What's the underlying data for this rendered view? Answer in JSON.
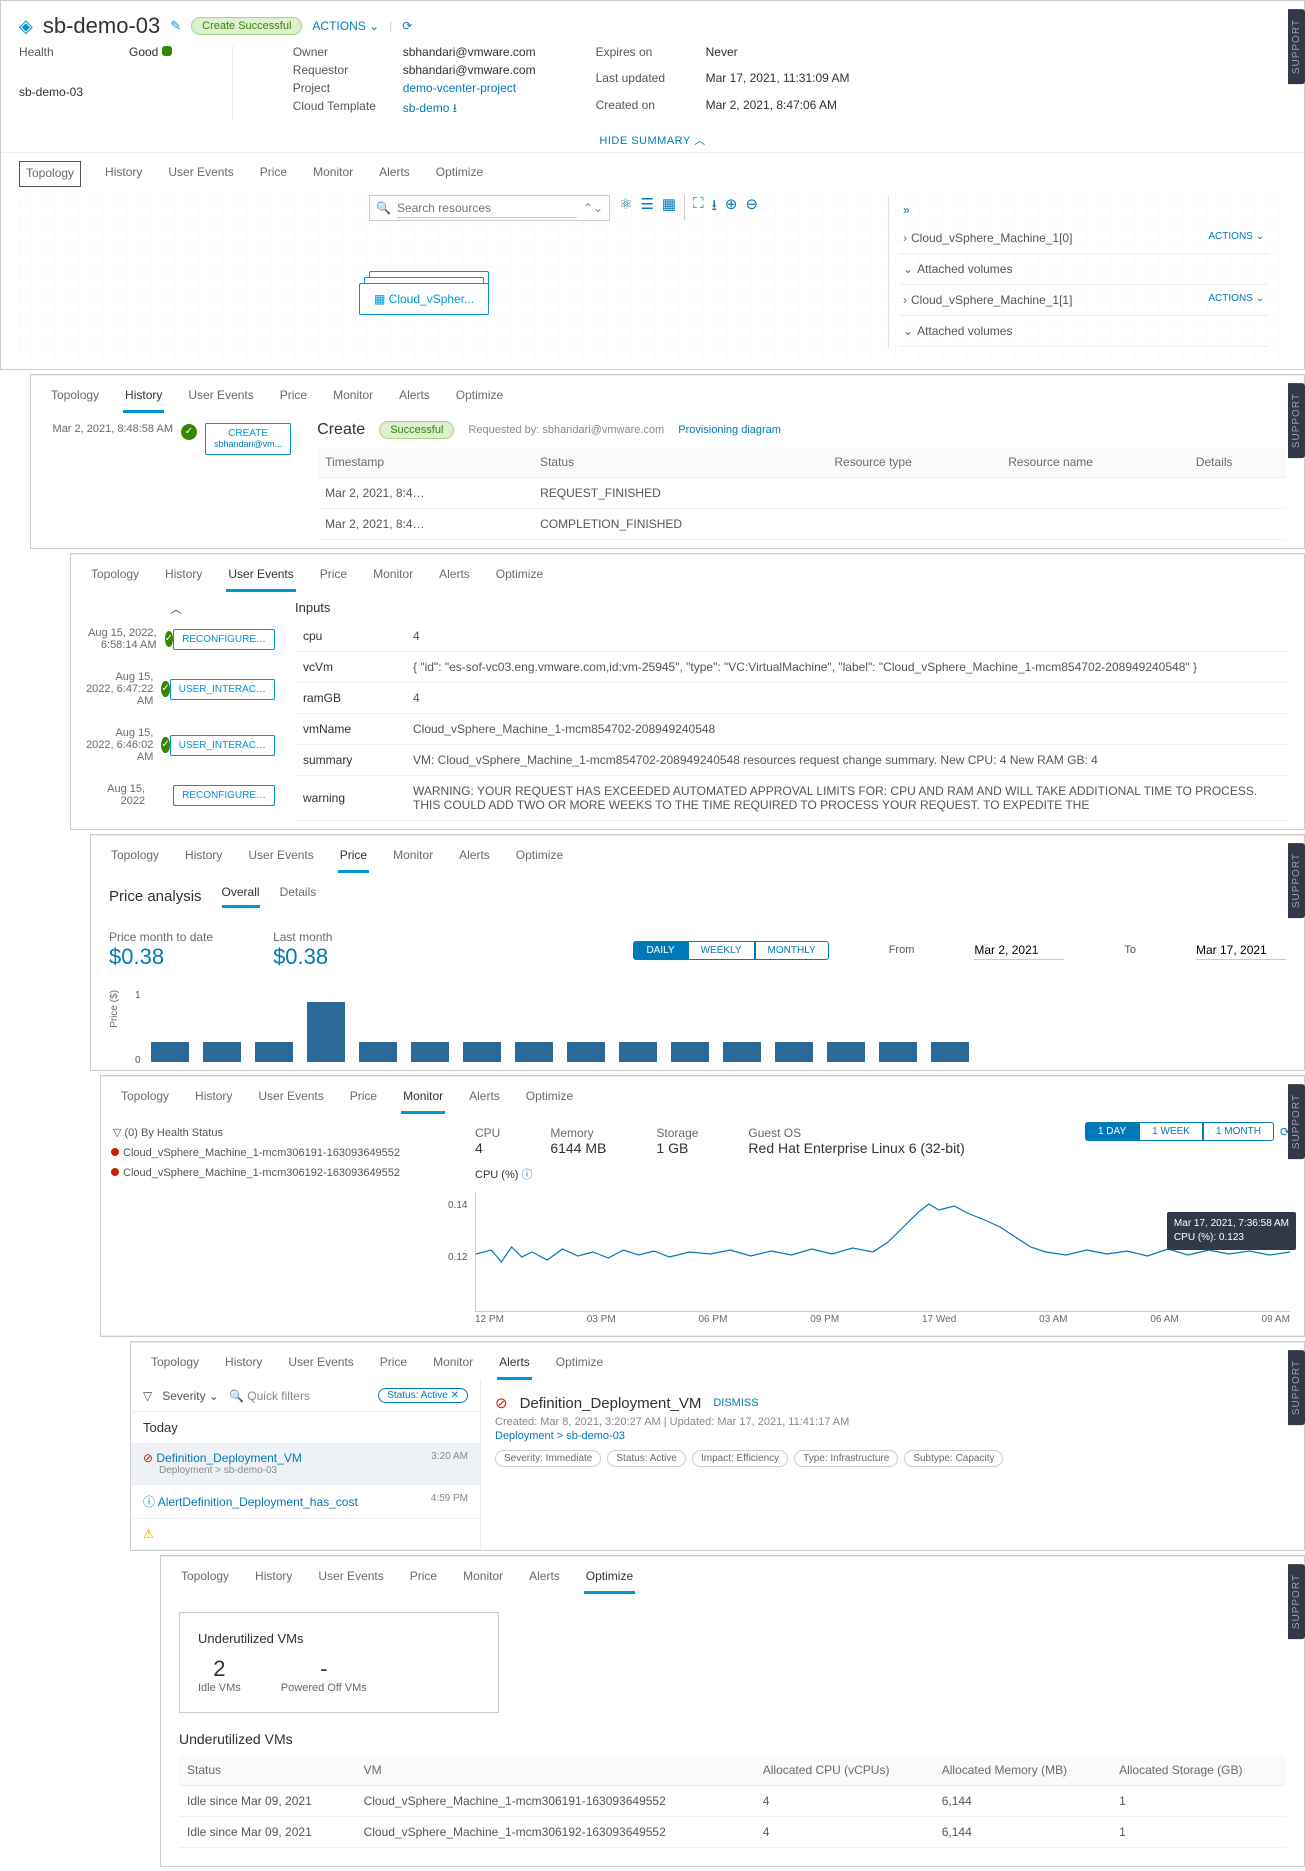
{
  "header": {
    "title": "sb-demo-03",
    "status_pill": "Create Successful",
    "actions": "ACTIONS",
    "refresh": "⟳"
  },
  "meta_left": {
    "health_lbl": "Health",
    "health_val": "Good",
    "name": "sb-demo-03"
  },
  "meta_mid": {
    "owner_lbl": "Owner",
    "owner": "sbhandari@vmware.com",
    "req_lbl": "Requestor",
    "req": "sbhandari@vmware.com",
    "proj_lbl": "Project",
    "proj": "demo-vcenter-project",
    "ct_lbl": "Cloud Template",
    "ct": "sb-demo"
  },
  "meta_right": {
    "exp_lbl": "Expires on",
    "exp": "Never",
    "upd_lbl": "Last updated",
    "upd": "Mar 17, 2021, 11:31:09 AM",
    "cre_lbl": "Created on",
    "cre": "Mar 2, 2021, 8:47:06 AM"
  },
  "hide_summary": "HIDE SUMMARY ︿",
  "tabs": [
    "Topology",
    "History",
    "User Events",
    "Price",
    "Monitor",
    "Alerts",
    "Optimize"
  ],
  "topology": {
    "search_ph": "Search resources",
    "node": "Cloud_vSpher...",
    "rp": [
      {
        "t": "Cloud_vSphere_Machine_1[0]",
        "a": "ACTIONS ⌄"
      },
      {
        "t": "Attached volumes",
        "exp": true
      },
      {
        "t": "Cloud_vSphere_Machine_1[1]",
        "a": "ACTIONS ⌄"
      },
      {
        "t": "Attached volumes",
        "exp": true
      }
    ]
  },
  "history": {
    "create": "Create",
    "pill": "Successful",
    "reqby": "Requested by: sbhandari@vmware.com",
    "prov": "Provisioning diagram",
    "ev": {
      "time": "Mar 2, 2021, 8:48:58 AM",
      "btn": "CREATE",
      "who": "sbhandari@vm..."
    },
    "cols": [
      "Timestamp",
      "Status",
      "Resource type",
      "Resource name",
      "Details"
    ],
    "rows": [
      {
        "ts": "Mar 2, 2021, 8:4…",
        "st": "REQUEST_FINISHED"
      },
      {
        "ts": "Mar 2, 2021, 8:4…",
        "st": "COMPLETION_FINISHED"
      }
    ]
  },
  "userevents": {
    "inputs_lbl": "Inputs",
    "evlist": [
      {
        "t": "Aug 15, 2022, 6:58:14 AM",
        "b": "RECONFIGURE…"
      },
      {
        "t": "Aug 15, 2022, 6:47:22 AM",
        "b": "USER_INTERAC…"
      },
      {
        "t": "Aug 15, 2022, 6:46:02 AM",
        "b": "USER_INTERAC…"
      },
      {
        "t": "Aug 15, 2022",
        "b": "RECONFIGURE…"
      }
    ],
    "kv": [
      {
        "k": "cpu",
        "v": "4"
      },
      {
        "k": "vcVm",
        "v": "{ \"id\": \"es-sof-vc03.eng.vmware.com,id:vm-25945\", \"type\": \"VC:VirtualMachine\", \"label\": \"Cloud_vSphere_Machine_1-mcm854702-208949240548\" }"
      },
      {
        "k": "ramGB",
        "v": "4"
      },
      {
        "k": "vmName",
        "v": "Cloud_vSphere_Machine_1-mcm854702-208949240548"
      },
      {
        "k": "summary",
        "v": "VM: Cloud_vSphere_Machine_1-mcm854702-208949240548 resources request change summary. New CPU: 4 New RAM GB: 4"
      },
      {
        "k": "warning",
        "v": "WARNING: YOUR REQUEST HAS EXCEEDED AUTOMATED APPROVAL LIMITS FOR: CPU AND RAM AND WILL TAKE ADDITIONAL TIME TO PROCESS. THIS COULD ADD TWO OR MORE WEEKS TO THE TIME REQUIRED TO PROCESS YOUR REQUEST. TO EXPEDITE THE"
      }
    ]
  },
  "price": {
    "title": "Price analysis",
    "subtabs": [
      "Overall",
      "Details"
    ],
    "mtd_lbl": "Price month to date",
    "mtd": "$0.38",
    "lm_lbl": "Last month",
    "lm": "$0.38",
    "range": [
      "DAILY",
      "WEEKLY",
      "MONTHLY"
    ],
    "from_lbl": "From",
    "from": "Mar 2, 2021",
    "to_lbl": "To",
    "to": "Mar 17, 2021",
    "ylabel": "Price ($)"
  },
  "monitor": {
    "filter": "(0) By Health Status",
    "vms": [
      "Cloud_vSphere_Machine_1-mcm306191-163093649552",
      "Cloud_vSphere_Machine_1-mcm306192-163093649552"
    ],
    "stats": {
      "cpu_l": "CPU",
      "cpu": "4",
      "mem_l": "Memory",
      "mem": "6144 MB",
      "stor_l": "Storage",
      "stor": "1 GB",
      "os_l": "Guest OS",
      "os": "Red Hat Enterprise Linux 6 (32-bit)"
    },
    "range": [
      "1 DAY",
      "1 WEEK",
      "1 MONTH"
    ],
    "chart_lbl": "CPU (%)",
    "yt": [
      "0.14",
      "0.12"
    ],
    "xt": [
      "12 PM",
      "03 PM",
      "06 PM",
      "09 PM",
      "17 Wed",
      "03 AM",
      "06 AM",
      "09 AM"
    ],
    "tooltip": {
      "t": "Mar 17, 2021, 7:36:58 AM",
      "v": "CPU (%): 0.123"
    }
  },
  "alerts": {
    "sev": "Severity",
    "qf": "Quick filters",
    "chip": "Status: Active ✕",
    "today": "Today",
    "items": [
      {
        "n": "Definition_Deployment_VM",
        "sub": "Deployment > sb-demo-03",
        "tm": "3:20 AM",
        "icon": "!"
      },
      {
        "n": "AlertDefinition_Deployment_has_cost",
        "tm": "4:59 PM",
        "icon": "i"
      }
    ],
    "detail": {
      "name": "Definition_Deployment_VM",
      "dismiss": "DISMISS",
      "meta": "Created: Mar 8, 2021, 3:20:27 AM  |  Updated: Mar 17, 2021, 11:41:17 AM",
      "bc": "Deployment > sb-demo-03",
      "badges": [
        "Severity: Immediate",
        "Status: Active",
        "Impact: Efficiency",
        "Type: Infrastructure",
        "Subtype: Capacity"
      ]
    }
  },
  "optimize": {
    "box_title": "Underutilized VMs",
    "idle_n": "2",
    "idle_l": "Idle VMs",
    "off_n": "-",
    "off_l": "Powered Off VMs",
    "tbl_title": "Underutilized VMs",
    "cols": [
      "Status",
      "VM",
      "Allocated CPU (vCPUs)",
      "Allocated Memory (MB)",
      "Allocated Storage (GB)"
    ],
    "rows": [
      {
        "s": "Idle since Mar 09, 2021",
        "v": "Cloud_vSphere_Machine_1-mcm306191-163093649552",
        "c": "4",
        "m": "6,144",
        "g": "1"
      },
      {
        "s": "Idle since Mar 09, 2021",
        "v": "Cloud_vSphere_Machine_1-mcm306192-163093649552",
        "c": "4",
        "m": "6,144",
        "g": "1"
      }
    ]
  },
  "support": "SUPPORT",
  "chart_data": [
    {
      "type": "bar",
      "title": "Price ($)",
      "ylim": [
        0,
        1
      ],
      "values": [
        0.33,
        0.33,
        0.33,
        1.0,
        0.33,
        0.33,
        0.33,
        0.33,
        0.33,
        0.33,
        0.33,
        0.33,
        0.33,
        0.33,
        0.33,
        0.33
      ]
    },
    {
      "type": "line",
      "title": "CPU (%)",
      "ylim": [
        0.11,
        0.145
      ],
      "x": [
        "12 PM",
        "03 PM",
        "06 PM",
        "09 PM",
        "17 Wed",
        "03 AM",
        "06 AM",
        "09 AM"
      ],
      "note": "noisy series ~0.12 with spike to ~0.14 near 09 PM–17 Wed; tooltip value 0.123 at 7:36:58 AM"
    }
  ]
}
